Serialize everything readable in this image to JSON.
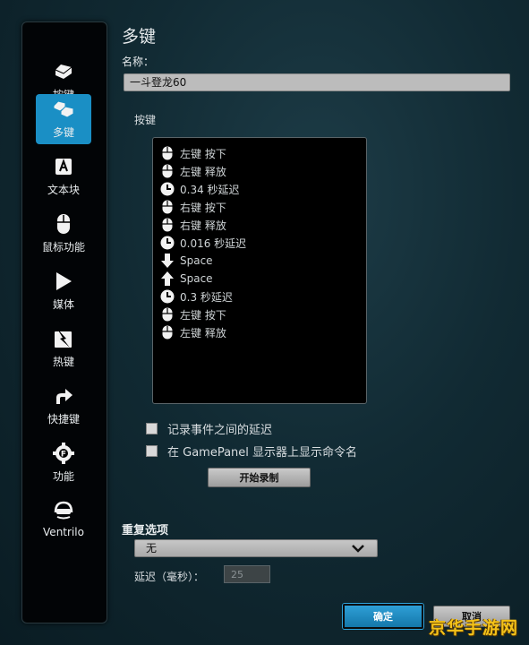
{
  "sidebar": {
    "items": [
      {
        "label": "按键",
        "icon": "key-icon"
      },
      {
        "label": "多键",
        "icon": "multi-key-icon",
        "active": true
      },
      {
        "label": "文本块",
        "icon": "text-block-icon"
      },
      {
        "label": "鼠标功能",
        "icon": "mouse-icon"
      },
      {
        "label": "媒体",
        "icon": "play-icon"
      },
      {
        "label": "热键",
        "icon": "hotkey-icon"
      },
      {
        "label": "快捷键",
        "icon": "shortcut-arrow-icon"
      },
      {
        "label": "功能",
        "icon": "function-gear-icon"
      },
      {
        "label": "Ventrilo",
        "icon": "ventrilo-headset-icon"
      }
    ]
  },
  "main": {
    "title": "多键",
    "name_label": "名称：",
    "name_value": "一斗登龙60",
    "keys_label": "按键",
    "key_events": [
      {
        "icon": "mouse-icon",
        "text": "左键 按下"
      },
      {
        "icon": "mouse-icon",
        "text": "左键 释放"
      },
      {
        "icon": "clock-icon",
        "text": "0.34 秒延迟"
      },
      {
        "icon": "mouse-icon",
        "text": "右键 按下"
      },
      {
        "icon": "mouse-icon",
        "text": "右键 释放"
      },
      {
        "icon": "clock-icon",
        "text": "0.016 秒延迟"
      },
      {
        "icon": "arrow-down-icon",
        "text": "Space"
      },
      {
        "icon": "arrow-up-icon",
        "text": "Space"
      },
      {
        "icon": "clock-icon",
        "text": "0.3 秒延迟"
      },
      {
        "icon": "mouse-icon",
        "text": "左键 按下"
      },
      {
        "icon": "mouse-icon",
        "text": "左键 释放"
      }
    ],
    "checkbox_record_delay": "记录事件之间的延迟",
    "checkbox_gamepanel": "在 GamePanel 显示器上显示命令名",
    "record_button": "开始录制",
    "repeat_label": "重复选项",
    "repeat_value": "无",
    "delay_label": "延迟（毫秒）：",
    "delay_value": "25",
    "ok_button": "确定",
    "cancel_button": "取消",
    "watermark": "京华手游网"
  }
}
